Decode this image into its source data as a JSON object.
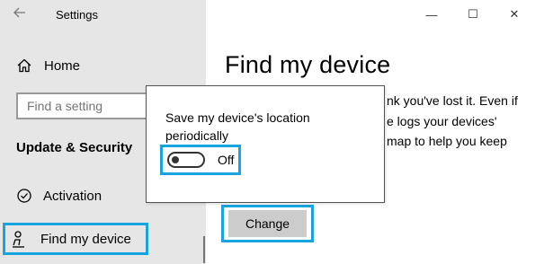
{
  "window": {
    "title": "Settings",
    "controls": {
      "minimize": "—",
      "maximize": "☐",
      "close": "✕"
    }
  },
  "sidebar": {
    "home_label": "Home",
    "search_placeholder": "Find a setting",
    "section_heading": "Update & Security",
    "items": [
      {
        "label": "Activation",
        "icon": "check-circle-icon"
      },
      {
        "label": "Find my device",
        "icon": "person-pin-icon",
        "selected": true
      }
    ]
  },
  "main": {
    "title": "Find my device",
    "body_lines": [
      "nk you've lost it. Even if",
      "e logs your devices'",
      "map to help you keep"
    ],
    "change_label": "Change"
  },
  "popup": {
    "label": "Save my device's location periodically",
    "toggle_state": "Off",
    "toggle_on": false
  },
  "colors": {
    "sidebar_bg": "#e6e6e6",
    "highlight": "#19a4df",
    "button_bg": "#cccccc"
  }
}
